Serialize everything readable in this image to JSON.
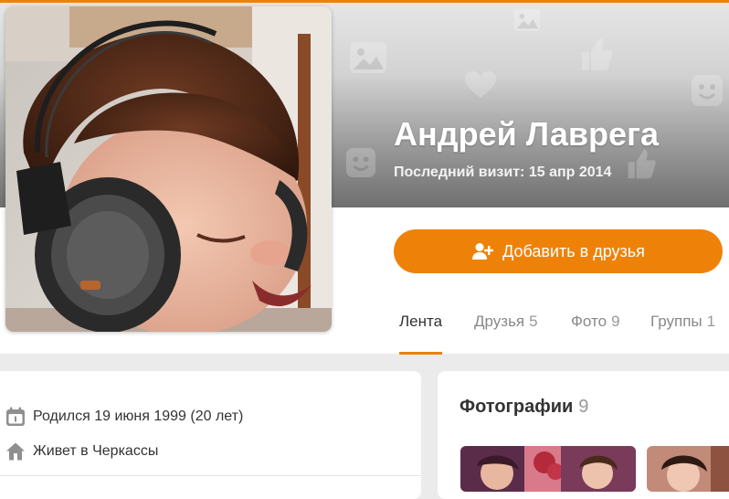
{
  "profile": {
    "name": "Андрей Лаврега",
    "last_visit": "Последний визит: 15 апр 2014"
  },
  "actions": {
    "add_friend_label": "Добавить в друзья"
  },
  "tabs": [
    {
      "label": "Лента",
      "count": "",
      "active": true
    },
    {
      "label": "Друзья",
      "count": "5",
      "active": false
    },
    {
      "label": "Фото",
      "count": "9",
      "active": false
    },
    {
      "label": "Группы",
      "count": "1",
      "active": false
    }
  ],
  "info": {
    "birthday": "Родился 19 июня 1999 (20 лет)",
    "lives_in": "Живет в Черкассы"
  },
  "photos": {
    "title": "Фотографии",
    "count": "9"
  },
  "colors": {
    "accent": "#ee8208",
    "page_bg": "#ebebeb",
    "card_bg": "#ffffff"
  },
  "icons": {
    "add_friend": "add-user-icon",
    "birthday": "calendar-icon",
    "home": "home-icon",
    "cover_pattern": [
      "photo-icon",
      "thumbs-up-icon",
      "heart-icon",
      "smile-icon"
    ]
  }
}
